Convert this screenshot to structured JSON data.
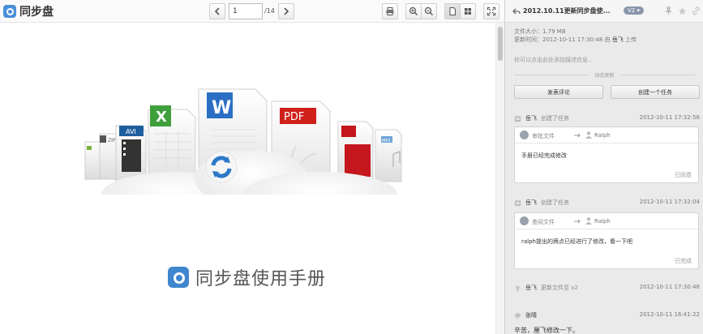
{
  "app": {
    "name": "同步盘"
  },
  "toolbar": {
    "page_current": "1",
    "page_total": "/14"
  },
  "document": {
    "manual_title": "同步盘使用手册"
  },
  "hero_labels": {
    "zip": "ZIP",
    "avi": "AVI",
    "word": "W",
    "excel": "X",
    "pdf": "PDF",
    "mp3": "MP3"
  },
  "panel": {
    "file_title": "2012.10.11更新同步盘使...",
    "version": "V2 ▾",
    "size_label": "文件大小：1.79 MB",
    "updated_label": "更新时间：2012-10-11 17:30:48 由",
    "updated_user": "岳飞",
    "updated_action": "上传",
    "desc_hint": "你可以点击此处添加描述信息..",
    "activity_divider": "动态更新",
    "btn_comment": "发表评论",
    "btn_task": "创建一个任务"
  },
  "activities": [
    {
      "user": "岳飞",
      "verb": "创建了任务",
      "time": "2012-10-11 17:32:56",
      "card": {
        "action": "审批文件",
        "assignee": "Ralph",
        "body": "手册已经完成修改",
        "status": "已同意"
      }
    },
    {
      "user": "岳飞",
      "verb": "创建了任务",
      "time": "2012-10-11 17:32:04",
      "card": {
        "action": "查阅文件",
        "assignee": "Ralph",
        "body": "ralph提出的两点已经进行了修改，看一下吧",
        "status": "已完成"
      }
    },
    {
      "user": "岳飞",
      "verb": "更新文件至 v2",
      "time": "2012-10-11 17:30:48"
    },
    {
      "user": "张晴",
      "verb": "",
      "time": "2012-10-11 16:41:22",
      "comment": "辛苦，厘飞修改一下。"
    }
  ]
}
